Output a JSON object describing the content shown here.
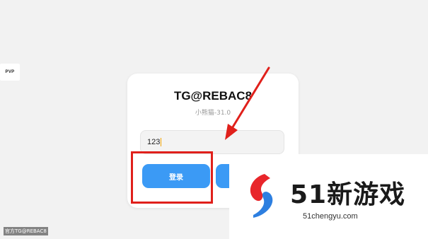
{
  "sidebar": {
    "badge": "PVP"
  },
  "card": {
    "title": "TG@REBAC8",
    "subtitle": "小熊猫-31.0",
    "input_value": "123",
    "login_label": "登录"
  },
  "footer": {
    "label": "官方TG@REBAC8"
  },
  "watermark": {
    "brand": "51新游戏",
    "domain": "51chengyu.com"
  },
  "colors": {
    "accent": "#3b9af5",
    "annotation": "#e0201b"
  }
}
